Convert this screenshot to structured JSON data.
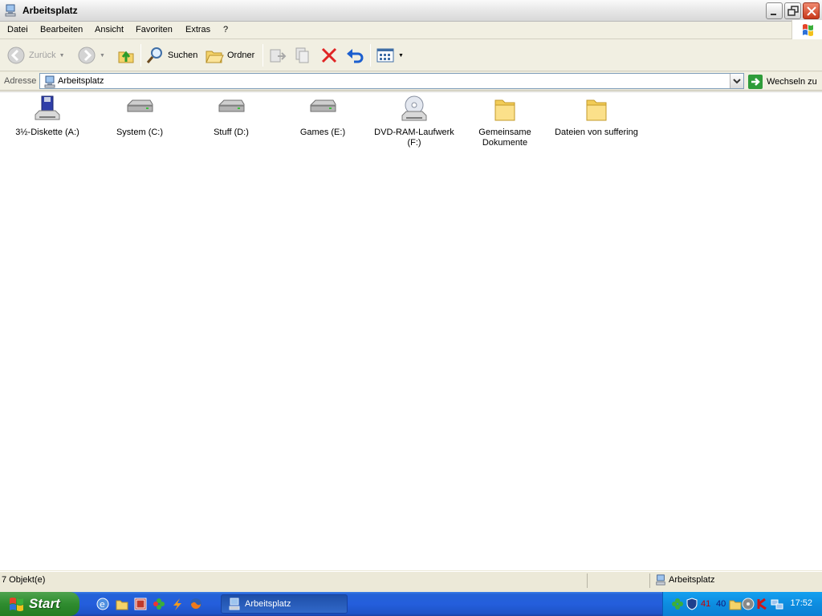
{
  "window": {
    "title": "Arbeitsplatz"
  },
  "menu": [
    "Datei",
    "Bearbeiten",
    "Ansicht",
    "Favoriten",
    "Extras",
    "?"
  ],
  "toolbar": {
    "back_label": "Zurück",
    "search_label": "Suchen",
    "folders_label": "Ordner",
    "icons": [
      "back-icon",
      "forward-icon",
      "up-folder-icon",
      "search-icon",
      "folders-icon",
      "move-to-icon",
      "copy-to-icon",
      "delete-icon",
      "undo-icon",
      "views-icon"
    ]
  },
  "address": {
    "label": "Adresse",
    "value": "Arbeitsplatz",
    "go_label": "Wechseln zu"
  },
  "items": [
    {
      "line1": "3½-Diskette (A:)",
      "line2": "",
      "icon": "floppy-drive-icon"
    },
    {
      "line1": "System (C:)",
      "line2": "",
      "icon": "hard-drive-icon"
    },
    {
      "line1": "Stuff (D:)",
      "line2": "",
      "icon": "hard-drive-icon"
    },
    {
      "line1": "Games (E:)",
      "line2": "",
      "icon": "hard-drive-icon"
    },
    {
      "line1": "DVD-RAM-Laufwerk",
      "line2": "(F:)",
      "icon": "dvd-drive-icon"
    },
    {
      "line1": "Gemeinsame",
      "line2": "Dokumente",
      "icon": "folder-icon"
    },
    {
      "line1": "Dateien von suffering",
      "line2": "",
      "icon": "folder-icon"
    }
  ],
  "status": {
    "count": "7 Objekt(e)",
    "location": "Arbeitsplatz"
  },
  "taskbar": {
    "start_label": "Start",
    "task_label": "Arbeitsplatz",
    "tray_numbers": [
      "41",
      "40"
    ],
    "clock": "17:52"
  },
  "colors": {
    "taskbar_blue": "#245edc",
    "start_green": "#2f8c2f",
    "tray_blue": "#0d8de0"
  }
}
